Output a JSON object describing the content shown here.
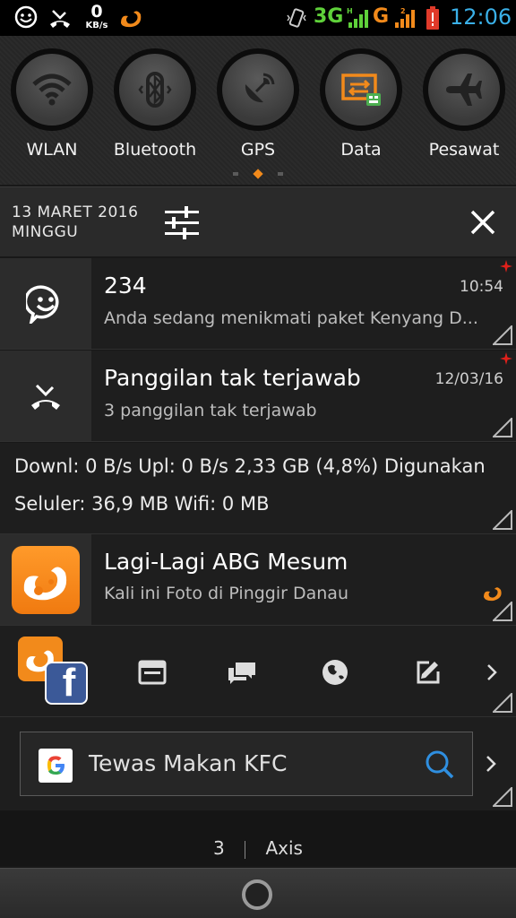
{
  "status_bar": {
    "speed_value": "0",
    "speed_unit": "KB/s",
    "network_3g": "3G",
    "network_g": "G",
    "time": "12:06"
  },
  "quick_settings": {
    "toggles": [
      {
        "label": "WLAN",
        "icon": "wifi-icon"
      },
      {
        "label": "Bluetooth",
        "icon": "bluetooth-icon"
      },
      {
        "label": "GPS",
        "icon": "gps-icon"
      },
      {
        "label": "Data",
        "icon": "data-transfer-icon"
      },
      {
        "label": "Pesawat",
        "icon": "airplane-icon"
      }
    ],
    "page_dots": 3,
    "active_dot": 1
  },
  "date_row": {
    "date": "13 MARET 2016",
    "day": "MINGGU"
  },
  "notifications": [
    {
      "title": "234",
      "time": "10:54",
      "text": "Anda sedang menikmati paket Kenyang D...",
      "icon": "message-smiley-icon"
    },
    {
      "title": "Panggilan tak terjawab",
      "time": "12/03/16",
      "text": "3 panggilan tak terjawab",
      "icon": "missed-call-icon"
    }
  ],
  "traffic": {
    "line1": "Downl: 0 B/s   Upl: 0 B/s    2,33 GB (4,8%) Digunakan",
    "line2": "Seluler: 36,9 MB    Wifi: 0 MB"
  },
  "uc_news": {
    "title": "Lagi-Lagi ABG Mesum",
    "text": "Kali ini Foto di Pinggir Danau"
  },
  "search": {
    "query": "Tewas Makan KFC"
  },
  "home_screen": {
    "page_number": "3",
    "page_label": "Axis"
  },
  "colors": {
    "accent_orange": "#f28a1b",
    "clock_blue": "#3ab0e8",
    "net_green": "#5fd13a"
  }
}
